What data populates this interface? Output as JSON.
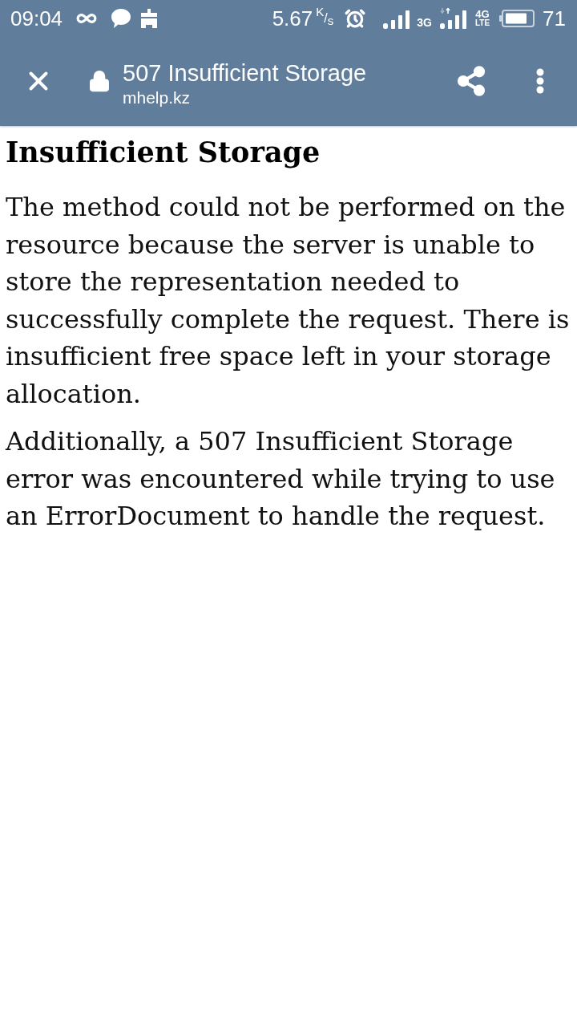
{
  "status_bar": {
    "time": "09:04",
    "speed": "5.67",
    "speed_unit": "$^{K}$/$_{s}$",
    "network_1": "3G",
    "network_2": "4G",
    "network_2_sub": "LTE",
    "battery": "71"
  },
  "toolbar": {
    "page_title": "507 Insufficient Storage",
    "url": "mhelp.kz"
  },
  "page": {
    "heading": "Insufficient Storage",
    "paragraphs": [
      "The method could not be performed on the resource because the server is unable to store the representation needed to successfully complete the request. There is insufficient free space left in your storage allocation.",
      "Additionally, a 507 Insufficient Storage error was encountered while trying to use an ErrorDocument to handle the request."
    ]
  }
}
